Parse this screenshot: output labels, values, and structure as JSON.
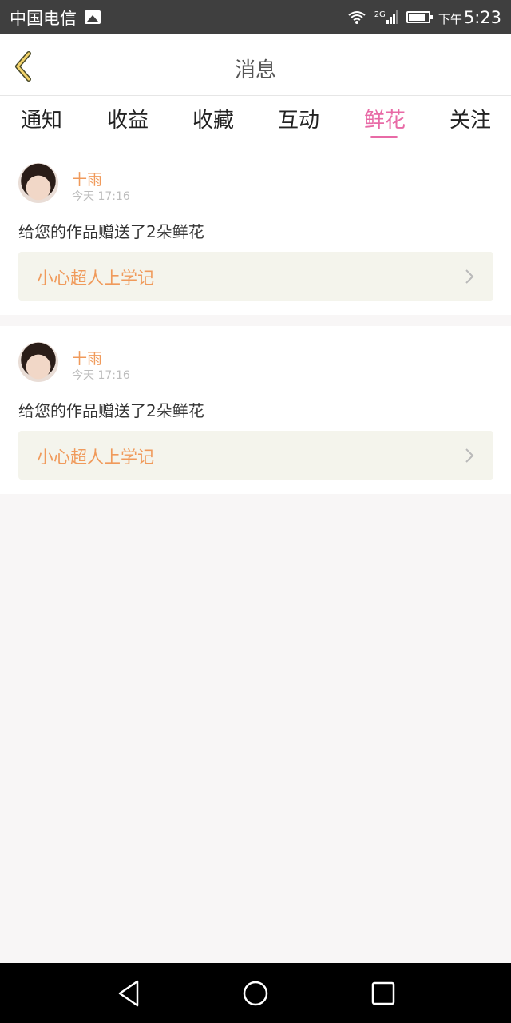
{
  "status_bar": {
    "carrier": "中国电信",
    "network": "2G",
    "time_prefix": "下午",
    "time": "5:23"
  },
  "header": {
    "title": "消息",
    "back_icon": "chevron-left-icon"
  },
  "tabs": [
    {
      "label": "通知"
    },
    {
      "label": "收益"
    },
    {
      "label": "收藏"
    },
    {
      "label": "互动"
    },
    {
      "label": "鲜花",
      "active": true
    },
    {
      "label": "关注"
    }
  ],
  "accent_color": "#e86aa6",
  "messages": [
    {
      "user": "十雨",
      "time": "今天 17:16",
      "text": "给您的作品赠送了2朵鲜花",
      "work_title": "小心超人上学记"
    },
    {
      "user": "十雨",
      "time": "今天 17:16",
      "text": "给您的作品赠送了2朵鲜花",
      "work_title": "小心超人上学记"
    }
  ],
  "nav_bar": {
    "back": "back-triangle-icon",
    "home": "home-circle-icon",
    "recents": "recents-square-icon"
  }
}
